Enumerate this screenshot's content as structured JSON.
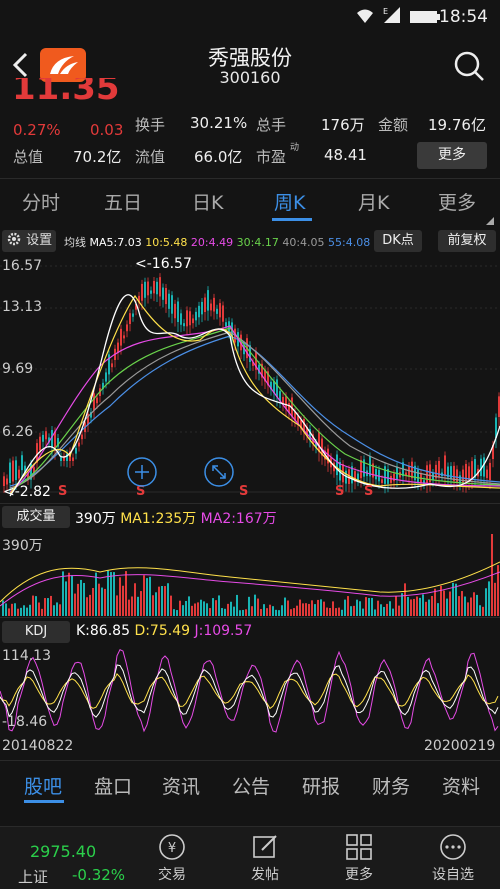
{
  "status": {
    "time": "18:54"
  },
  "header": {
    "name": "秀强股份",
    "code": "300160"
  },
  "quote": {
    "price": "11.35",
    "change_pct": "0.27%",
    "change_abs": "0.03",
    "turnover_label": "换手",
    "turnover": "30.21%",
    "volume_label": "总手",
    "volume": "176万",
    "amount_label": "金额",
    "amount": "19.76亿",
    "mcap_label": "总值",
    "mcap": "70.2亿",
    "float_label": "流值",
    "float_val": "66.0亿",
    "pe_label": "市盈",
    "pe_sup": "动",
    "pe": "48.41",
    "more_label": "更多"
  },
  "tabs": [
    {
      "label": "分时"
    },
    {
      "label": "五日"
    },
    {
      "label": "日K"
    },
    {
      "label": "周K"
    },
    {
      "label": "月K"
    },
    {
      "label": "更多"
    }
  ],
  "ma_row": {
    "settings": "设置",
    "title": "均线",
    "ma5": "MA5:7.03",
    "ma10": "10:5.48",
    "ma20": "20:4.49",
    "ma30": "30:4.17",
    "ma40": "40:4.05",
    "ma55": "55:4.08",
    "dk_label": "DK点",
    "adjust_label": "前复权"
  },
  "price_axis": [
    "16.57",
    "13.13",
    "9.69",
    "6.26"
  ],
  "price_annotations": {
    "high": "<-16.57",
    "low": "<-2.82",
    "s_mark": "S"
  },
  "volume": {
    "button": "成交量",
    "current": "390万",
    "ma1": "MA1:235万",
    "ma2": "MA2:167万",
    "axis_max": "390万"
  },
  "kdj": {
    "button": "KDJ",
    "k": "K:86.85",
    "d": "D:75.49",
    "j": "J:109.57",
    "axis_max": "114.13",
    "axis_min": "-18.46"
  },
  "dates": {
    "start": "20140822",
    "end": "20200219"
  },
  "bottom_tabs": [
    {
      "label": "股吧"
    },
    {
      "label": "盘口"
    },
    {
      "label": "资讯"
    },
    {
      "label": "公告"
    },
    {
      "label": "研报"
    },
    {
      "label": "财务"
    },
    {
      "label": "资料"
    }
  ],
  "nav": {
    "index_value": "2975.40",
    "index_name": "上证",
    "index_change": "-0.32%",
    "trade": "交易",
    "post": "发帖",
    "more": "更多",
    "watch": "设自选"
  },
  "colors": {
    "up": "#e23a3a",
    "down": "#19b4b4",
    "accent": "#3c8fe6",
    "ma5": "#ffffff",
    "ma10": "#ffe14b",
    "ma20": "#e64be6",
    "ma30": "#69d24b",
    "ma40": "#9a9a9a",
    "ma55": "#4b8fe6"
  }
}
